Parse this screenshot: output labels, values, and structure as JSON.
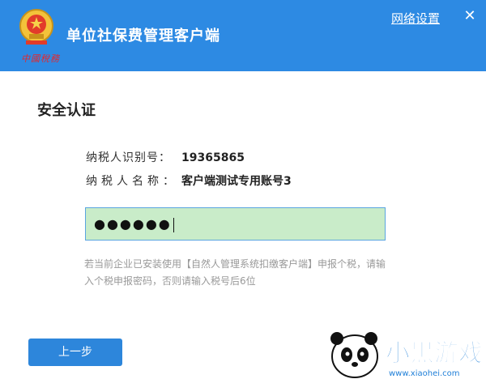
{
  "header": {
    "title": "单位社保费管理客户端",
    "logo_caption": "中國稅務",
    "network_link": "网络设置",
    "close_icon": "✕",
    "bg_color": "#2d8ae3"
  },
  "auth": {
    "section_title": "安全认证",
    "taxpayer_id_label": "纳税人识别号：",
    "taxpayer_id_value": "19365865",
    "taxpayer_name_label": "纳税人名称：",
    "taxpayer_name_value": "客户端测试专用账号3",
    "password_value": "●●●●●●",
    "hint": "若当前企业已安装使用【自然人管理系统扣缴客户端】申报个税，请输入个税申报密码，否则请输入税号后6位"
  },
  "footer": {
    "back_label": "上一步"
  },
  "watermark": {
    "brand_text": "小黑游戏",
    "url_text": "www.xiaohei.com",
    "icon": "panda-icon"
  }
}
